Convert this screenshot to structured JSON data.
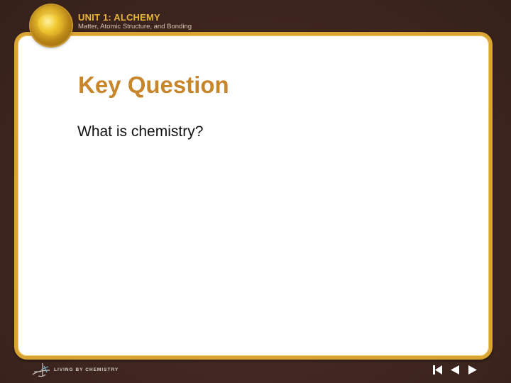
{
  "header": {
    "unit_title": "UNIT 1: ALCHEMY",
    "unit_subtitle": "Matter, Atomic Structure, and Bonding"
  },
  "slide": {
    "title": "Key Question",
    "body": "What is chemistry?"
  },
  "footer": {
    "brand": "LIVING BY CHEMISTRY"
  },
  "nav": {
    "icons": [
      "first-slide-icon",
      "previous-slide-icon",
      "next-slide-icon"
    ]
  },
  "colors": {
    "background": "#3e261f",
    "border": "#d9a431",
    "title": "#c8862a"
  }
}
